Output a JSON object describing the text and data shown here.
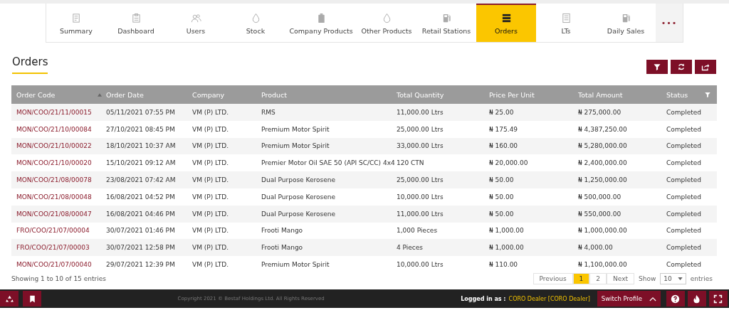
{
  "tabs": [
    {
      "label": "Summary",
      "selected": false
    },
    {
      "label": "Dashboard",
      "selected": false
    },
    {
      "label": "Users",
      "selected": false
    },
    {
      "label": "Stock",
      "selected": false
    },
    {
      "label": "Company Products",
      "selected": false
    },
    {
      "label": "Other Products",
      "selected": false
    },
    {
      "label": "Retail Stations",
      "selected": false
    },
    {
      "label": "Orders",
      "selected": true
    },
    {
      "label": "LTs",
      "selected": false
    },
    {
      "label": "Daily Sales",
      "selected": false
    }
  ],
  "more": "•••",
  "page_title": "Orders",
  "table": {
    "columns": [
      {
        "label": "Order Code",
        "sorted": true
      },
      {
        "label": "Order Date",
        "sorted": false
      },
      {
        "label": "Company",
        "sorted": false
      },
      {
        "label": "Product",
        "sorted": false
      },
      {
        "label": "Total Quantity",
        "sorted": false
      },
      {
        "label": "Price Per Unit",
        "sorted": false
      },
      {
        "label": "Total Amount",
        "sorted": false
      },
      {
        "label": "Status",
        "sorted": false
      }
    ],
    "rows": [
      [
        "MON/COO/21/11/00015",
        "05/11/2021 07:55 PM",
        "VM (P) LTD.",
        "RMS",
        "11,000.00 Ltrs",
        "₦ 25.00",
        "₦ 275,000.00",
        "Completed"
      ],
      [
        "MON/COO/21/10/00084",
        "27/10/2021 08:45 PM",
        "VM (P) LTD.",
        "Premium Motor Spirit",
        "25,000.00 Ltrs",
        "₦ 175.49",
        "₦ 4,387,250.00",
        "Completed"
      ],
      [
        "MON/COO/21/10/00022",
        "18/10/2021 10:37 AM",
        "VM (P) LTD.",
        "Premium Motor Spirit",
        "33,000.00 Ltrs",
        "₦ 160.00",
        "₦ 5,280,000.00",
        "Completed"
      ],
      [
        "MON/COO/21/10/00020",
        "15/10/2021 09:12 AM",
        "VM (P) LTD.",
        "Premier Motor Oil SAE 50 (API SC/CC) 4x4",
        "120 CTN",
        "₦ 20,000.00",
        "₦ 2,400,000.00",
        "Completed"
      ],
      [
        "MON/COO/21/08/00078",
        "23/08/2021 07:42 AM",
        "VM (P) LTD.",
        "Dual Purpose Kerosene",
        "25,000.00 Ltrs",
        "₦ 50.00",
        "₦ 1,250,000.00",
        "Completed"
      ],
      [
        "MON/COO/21/08/00048",
        "16/08/2021 04:52 PM",
        "VM (P) LTD.",
        "Dual Purpose Kerosene",
        "10,000.00 Ltrs",
        "₦ 50.00",
        "₦ 500,000.00",
        "Completed"
      ],
      [
        "MON/COO/21/08/00047",
        "16/08/2021 04:46 PM",
        "VM (P) LTD.",
        "Dual Purpose Kerosene",
        "11,000.00 Ltrs",
        "₦ 50.00",
        "₦ 550,000.00",
        "Completed"
      ],
      [
        "FRO/COO/21/07/00004",
        "30/07/2021 01:46 PM",
        "VM (P) LTD.",
        "Frooti Mango",
        "1,000 Pieces",
        "₦ 1,000.00",
        "₦ 1,000,000.00",
        "Completed"
      ],
      [
        "FRO/COO/21/07/00003",
        "30/07/2021 12:58 PM",
        "VM (P) LTD.",
        "Frooti Mango",
        "4 Pieces",
        "₦ 1,000.00",
        "₦ 4,000.00",
        "Completed"
      ],
      [
        "MON/COO/21/07/00040",
        "29/07/2021 12:39 PM",
        "VM (P) LTD.",
        "Premium Motor Spirit",
        "10,000.00 Ltrs",
        "₦ 110.00",
        "₦ 1,100,000.00",
        "Completed"
      ]
    ]
  },
  "info": "Showing 1 to 10 of 15 entries",
  "pagination": {
    "previous": "Previous",
    "pages": [
      {
        "label": "1",
        "selected": true
      },
      {
        "label": "2",
        "selected": false
      }
    ],
    "next": "Next"
  },
  "length": {
    "show": "Show",
    "value": "10",
    "entries": "entries"
  },
  "footer": {
    "copyright": "Copyright 2021 © Bestaf Holdings Ltd. All Rights Reserved",
    "logged_label": "Logged in as :",
    "user": "CORO Dealer [CORO Dealer]",
    "switch": "Switch Profile"
  }
}
